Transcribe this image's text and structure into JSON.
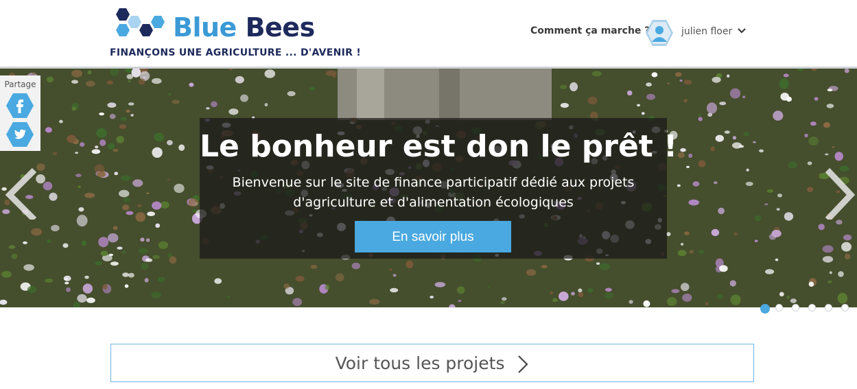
{
  "colors": {
    "brand_blue": "#3b9ad6",
    "brand_navy": "#1e2a5c",
    "button_blue": "#4aa9e0"
  },
  "header": {
    "logo_word1": "Blue",
    "logo_word2": "Bees",
    "tagline": "FINANÇONS UNE AGRICULTURE ... D'AVENIR !",
    "how_it_works": "Comment ça marche ?",
    "user_name": "julien floer",
    "avatar_icon": "user-avatar-icon",
    "menu_icon": "chevron-down-icon"
  },
  "share": {
    "label": "Partage",
    "facebook_icon": "facebook-icon",
    "twitter_icon": "twitter-icon"
  },
  "hero": {
    "title": "Le bonheur est don le prêt !",
    "subtitle": "Bienvenue sur le site de finance participatif dédié aux projets d'agriculture et d'alimentation écologiques",
    "cta": "En savoir plus",
    "slide_count": 6,
    "active_slide": 1
  },
  "projects": {
    "label": "Voir tous les projets"
  }
}
